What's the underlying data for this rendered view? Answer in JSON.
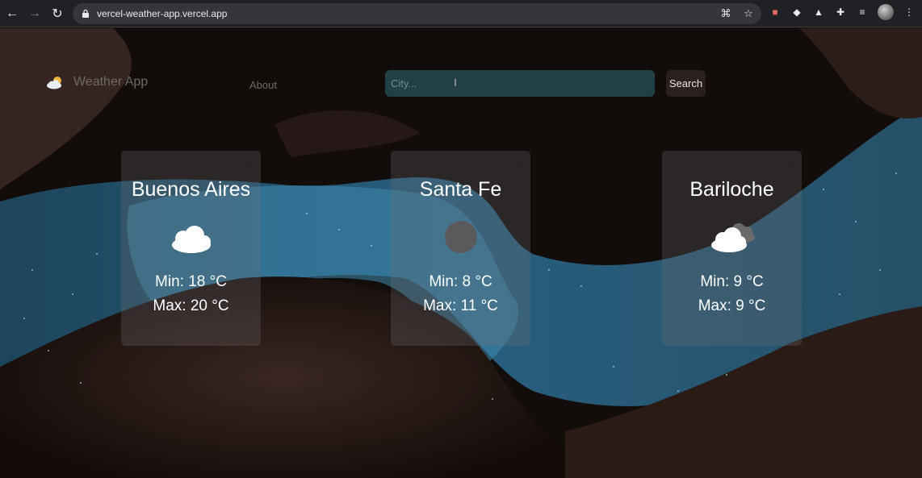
{
  "browser": {
    "url": "vercel-weather-app.vercel.app"
  },
  "header": {
    "brand_title": "Weather App",
    "about_label": "About",
    "search_placeholder": "City...",
    "search_button_label": "Search"
  },
  "cards": [
    {
      "city": "Buenos Aires",
      "min": "Min: 18 °C",
      "max": "Max: 20 °C",
      "icon": "cloud-icon",
      "close": "×"
    },
    {
      "city": "Santa Fe",
      "min": "Min: 8 °C",
      "max": "Max: 11 °C",
      "icon": "moon-icon",
      "close": "×"
    },
    {
      "city": "Bariloche",
      "min": "Min: 9 °C",
      "max": "Max: 9 °C",
      "icon": "broken-clouds-icon",
      "close": "×"
    }
  ],
  "colors": {
    "card_bg": "rgba(110,110,115,0.28)",
    "search_bg": "#28505a",
    "accent_sky": "#3f8ab0"
  }
}
